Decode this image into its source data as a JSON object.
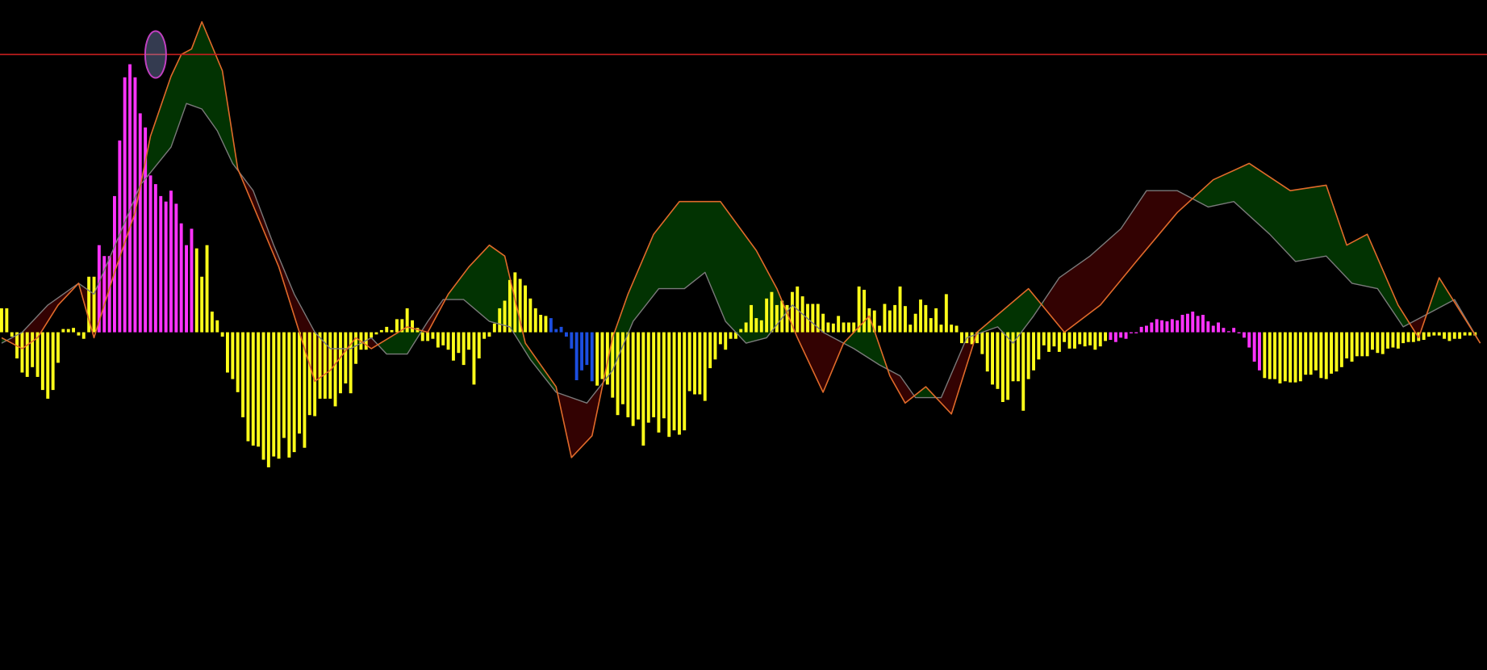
{
  "chart_data": {
    "type": "bar",
    "title": "",
    "xlabel": "",
    "ylabel": "",
    "grid": false,
    "ylim": [
      -31,
      30.5
    ],
    "x_count": 290,
    "reference_line": {
      "y": 25.5,
      "color": "#c81e1e"
    },
    "marker_ellipse": {
      "x": 30,
      "y": 25.5,
      "color": "#c040c0"
    },
    "colors": {
      "background": "#000000",
      "fast_line": "#e06a2a",
      "slow_line": "#7a7a7a",
      "fill_bull": "#023302",
      "fill_bear": "#330202",
      "hist_default": "#ffff1a",
      "hist_magenta": "#ff33ff",
      "hist_blue": "#1c4ee0"
    },
    "series": [
      {
        "role": "fast",
        "x": [
          0,
          4,
          7,
          11,
          15,
          18,
          22,
          26,
          29,
          33,
          35,
          37,
          39,
          43,
          46,
          50,
          54,
          57,
          61,
          64,
          69,
          72,
          79,
          83,
          87,
          91,
          95,
          98,
          102,
          108,
          111,
          115,
          119,
          122,
          127,
          132,
          140,
          147,
          151,
          155,
          160,
          164,
          169,
          173,
          176,
          180,
          185,
          190,
          195,
          200,
          207,
          214,
          221,
          229,
          236,
          243,
          251,
          258,
          262,
          266,
          272,
          276,
          280,
          288
        ],
        "y": [
          -0.5,
          -1.5,
          -0.5,
          2.5,
          4.5,
          -0.5,
          5.5,
          11,
          18,
          23.5,
          25.5,
          26,
          28.5,
          24,
          15,
          10.5,
          6,
          1.5,
          -4.5,
          -3.5,
          -0.5,
          -1.5,
          0.5,
          0,
          3.5,
          6,
          8,
          7,
          -1,
          -5,
          -11.5,
          -9.5,
          -0.5,
          3.5,
          9,
          12,
          12,
          7.5,
          4,
          -0.5,
          -5.5,
          -1,
          1.5,
          -4,
          -6.5,
          -5,
          -7.5,
          0,
          2,
          4,
          0,
          2.5,
          6.5,
          11,
          14,
          15.5,
          13,
          13.5,
          8,
          9,
          2.5,
          -0.5,
          5,
          -1
        ]
      },
      {
        "role": "slow",
        "x": [
          0,
          4,
          9,
          15,
          18,
          23,
          27,
          33,
          36,
          39,
          42,
          45,
          49,
          53,
          57,
          61,
          64,
          68,
          72,
          75,
          79,
          83,
          86,
          90,
          95,
          99,
          103,
          108,
          114,
          119,
          123,
          128,
          133,
          137,
          141,
          145,
          149,
          154,
          160,
          166,
          171,
          175,
          178,
          183,
          188,
          194,
          197,
          201,
          206,
          212,
          218,
          223,
          229,
          235,
          240,
          247,
          252,
          258,
          263,
          268,
          273,
          279,
          283,
          288
        ],
        "y": [
          -1,
          0,
          2.5,
          4.5,
          3.5,
          9,
          13.5,
          17,
          21,
          20.5,
          18.5,
          15.5,
          13,
          8,
          3.5,
          0,
          -1.5,
          -1.5,
          -0.5,
          -2,
          -2,
          1,
          3,
          3,
          1,
          0.5,
          -2.5,
          -5.5,
          -6.5,
          -3.5,
          1,
          4,
          4,
          5.5,
          1,
          -1,
          -0.5,
          2.5,
          0,
          -1.5,
          -3,
          -4,
          -6,
          -6,
          -0.5,
          0.5,
          -1,
          1.5,
          5,
          7,
          9.5,
          13,
          13,
          11.5,
          12,
          9,
          6.5,
          7,
          4.5,
          4,
          0.5,
          2,
          3,
          -1
        ]
      },
      {
        "role": "histogram",
        "values": [
          2.2,
          2.2,
          -0.4,
          -2.4,
          -3.7,
          -4.1,
          -3.2,
          -4.1,
          -5.3,
          -6.1,
          -5.3,
          -2.8,
          0.3,
          0.3,
          0.4,
          -0.3,
          -0.6,
          5.1,
          5.1,
          8.0,
          7.0,
          7.0,
          12.5,
          17.6,
          23.4,
          24.6,
          23.4,
          20.1,
          18.8,
          14.4,
          13.6,
          12.5,
          12.0,
          13.0,
          11.8,
          10.0,
          8.0,
          9.5,
          7.7,
          5.1,
          8.0,
          1.9,
          1.1,
          -0.4,
          -3.7,
          -4.3,
          -5.5,
          -7.8,
          -10.0,
          -10.4,
          -10.5,
          -11.7,
          -12.4,
          -11.4,
          -11.6,
          -9.7,
          -11.5,
          -11.0,
          -9.3,
          -10.6,
          -7.6,
          -7.7,
          -6.1,
          -6.1,
          -6.1,
          -6.8,
          -5.6,
          -4.7,
          -5.6,
          -2.9,
          -1.6,
          -1.6,
          -0.5,
          -0.2,
          0.2,
          0.5,
          0.2,
          1.2,
          1.2,
          2.2,
          1.1,
          0.4,
          -0.8,
          -0.8,
          -0.6,
          -1.4,
          -1.2,
          -1.6,
          -2.6,
          -1.9,
          -3.0,
          -1.6,
          -4.8,
          -2.4,
          -0.6,
          -0.4,
          0.8,
          2.2,
          2.9,
          4.8,
          5.5,
          4.9,
          4.3,
          3.1,
          2.2,
          1.6,
          1.5,
          1.3,
          0.3,
          0.5,
          -0.4,
          -1.5,
          -4.4,
          -3.5,
          -3.0,
          -4.5,
          -4.9,
          -4.3,
          -4.8,
          -6.0,
          -7.6,
          -6.6,
          -7.8,
          -8.6,
          -8.0,
          -10.4,
          -8.3,
          -7.8,
          -9.2,
          -7.9,
          -9.6,
          -9.0,
          -9.4,
          -9.0,
          -5.4,
          -5.7,
          -5.7,
          -6.3,
          -3.3,
          -2.5,
          -1.1,
          -1.6,
          -0.6,
          -0.6,
          0.3,
          0.9,
          2.5,
          1.3,
          1.1,
          3.1,
          3.7,
          2.5,
          2.9,
          2.5,
          3.7,
          4.2,
          3.3,
          2.6,
          2.6,
          2.6,
          1.7,
          0.9,
          0.8,
          1.5,
          0.9,
          0.9,
          0.9,
          4.2,
          3.9,
          2.2,
          2.0,
          0.6,
          2.6,
          2.0,
          2.5,
          4.2,
          2.4,
          0.7,
          1.7,
          3.0,
          2.5,
          1.3,
          2.2,
          0.7,
          3.5,
          0.7,
          0.6,
          -1.0,
          -1.0,
          -1.1,
          -1.0,
          -2.0,
          -3.6,
          -4.8,
          -5.2,
          -6.4,
          -6.2,
          -4.5,
          -4.5,
          -7.2,
          -4.3,
          -3.5,
          -2.5,
          -1.2,
          -1.8,
          -1.3,
          -1.8,
          -0.9,
          -1.5,
          -1.5,
          -1.1,
          -1.3,
          -1.2,
          -1.6,
          -1.3,
          -0.8,
          -0.7,
          -0.9,
          -0.5,
          -0.6,
          -0.1,
          -0.1,
          0.5,
          0.6,
          0.9,
          1.2,
          1.1,
          1.0,
          1.2,
          1.1,
          1.6,
          1.7,
          1.9,
          1.5,
          1.6,
          1.0,
          0.6,
          0.9,
          0.4,
          0.1,
          0.4,
          -0.1,
          -0.5,
          -1.4,
          -2.7,
          -3.5,
          -4.2,
          -4.3,
          -4.3,
          -4.7,
          -4.5,
          -4.6,
          -4.6,
          -4.5,
          -3.9,
          -3.9,
          -3.5,
          -4.2,
          -4.3,
          -3.8,
          -3.6,
          -3.2,
          -2.4,
          -2.7,
          -2.2,
          -2.2,
          -2.2,
          -1.6,
          -1.9,
          -2.0,
          -1.5,
          -1.4,
          -1.5,
          -1.0,
          -0.9,
          -0.9,
          -0.8,
          -0.7,
          -0.4,
          -0.3,
          -0.3,
          -0.6,
          -0.8,
          -0.6,
          -0.6,
          -0.3,
          -0.3,
          -0.3
        ],
        "magenta_indices": [
          19,
          20,
          21,
          22,
          23,
          24,
          25,
          26,
          27,
          28,
          29,
          30,
          31,
          32,
          33,
          34,
          35,
          36,
          37,
          216,
          217,
          218,
          219,
          220,
          221,
          222,
          223,
          224,
          225,
          226,
          227,
          228,
          229,
          230,
          231,
          232,
          233,
          234,
          235,
          236,
          237,
          238,
          239,
          240,
          241,
          242,
          243,
          244,
          245
        ],
        "blue_indices": [
          107,
          108,
          109,
          110,
          111,
          112,
          113,
          114,
          115
        ]
      }
    ]
  }
}
